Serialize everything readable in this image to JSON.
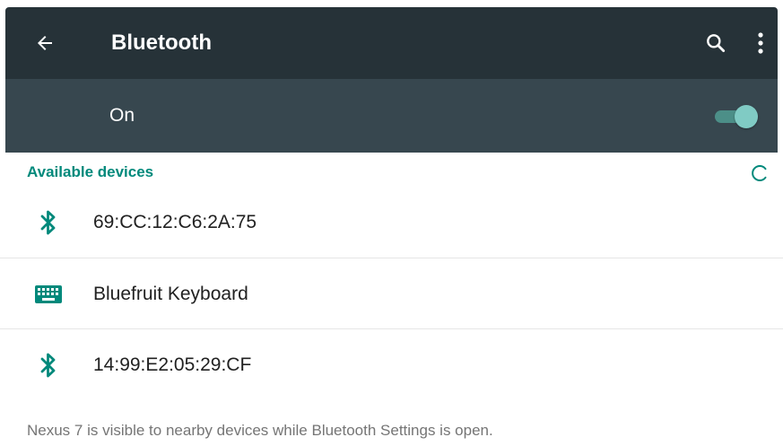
{
  "appbar": {
    "title": "Bluetooth",
    "icons": {
      "back": "arrow-back-icon",
      "search": "search-icon",
      "more": "more-vert-icon"
    }
  },
  "bluetooth_switch": {
    "label": "On",
    "state": true
  },
  "available_devices": {
    "header": "Available devices",
    "refresh_icon": "refresh-spinner-icon",
    "items": [
      {
        "label": "69:CC:12:C6:2A:75",
        "icon": "bluetooth-icon"
      },
      {
        "label": "Bluefruit Keyboard",
        "icon": "keyboard-icon"
      },
      {
        "label": "14:99:E2:05:29:CF",
        "icon": "bluetooth-icon"
      }
    ]
  },
  "footer": {
    "note": "Nexus 7 is visible to nearby devices while Bluetooth Settings is open."
  },
  "colors": {
    "appbar_bg": "#263238",
    "switchbar_bg": "#37474f",
    "accent": "#00897b",
    "toggle_thumb": "#80cbc4"
  }
}
